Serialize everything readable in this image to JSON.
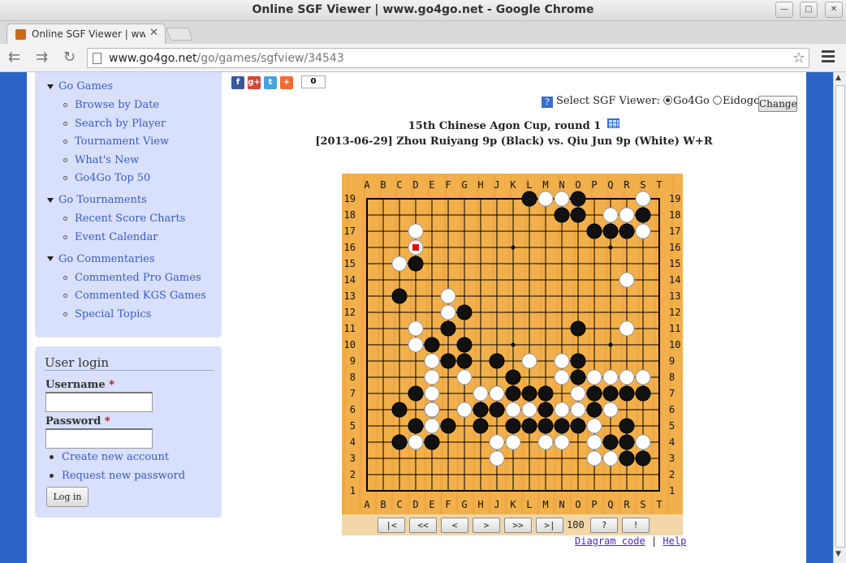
{
  "window": {
    "title": "Online SGF Viewer | www.go4go.net - Google Chrome"
  },
  "tab": {
    "title": "Online SGF Viewer | www.go4go.net"
  },
  "address": {
    "host": "www.go4go.net",
    "path": "/go/games/sgfview/34543"
  },
  "sidebar": {
    "sections": [
      {
        "label": "Go Games",
        "items": [
          "Browse by Date",
          "Search by Player",
          "Tournament View",
          "What's New",
          "Go4Go Top 50"
        ]
      },
      {
        "label": "Go Tournaments",
        "items": [
          "Recent Score Charts",
          "Event Calendar"
        ]
      },
      {
        "label": "Go Commentaries",
        "items": [
          "Commented Pro Games",
          "Commented KGS Games",
          "Special Topics"
        ]
      }
    ]
  },
  "login": {
    "title": "User login",
    "username_label": "Username",
    "password_label": "Password",
    "required_mark": "*",
    "username_value": "",
    "password_value": "",
    "create_account": "Create new account",
    "request_password": "Request new password",
    "login_button": "Log in"
  },
  "share": {
    "count": "0",
    "icons": [
      "facebook-icon",
      "google-plus-icon",
      "twitter-icon",
      "addthis-icon"
    ]
  },
  "viewer_select": {
    "help": "?",
    "label": "Select SGF Viewer:",
    "options": [
      "Go4Go",
      "Eidogo"
    ],
    "selected": "Go4Go",
    "change_button": "Change"
  },
  "game": {
    "event": "15th Chinese Agon Cup, round 1",
    "info": "[2013-06-29] Zhou Ruiyang 9p (Black) vs. Qiu Jun 9p (White) W+R"
  },
  "board": {
    "size": 19,
    "col_labels": [
      "A",
      "B",
      "C",
      "D",
      "E",
      "F",
      "G",
      "H",
      "J",
      "K",
      "L",
      "M",
      "N",
      "O",
      "P",
      "Q",
      "R",
      "S",
      "T"
    ],
    "black": [
      [
        10,
        18
      ],
      [
        13,
        18
      ],
      [
        12,
        17
      ],
      [
        13,
        17
      ],
      [
        14,
        16
      ],
      [
        15,
        16
      ],
      [
        16,
        16
      ],
      [
        17,
        17
      ],
      [
        3,
        14
      ],
      [
        2,
        12
      ],
      [
        6,
        11
      ],
      [
        5,
        10
      ],
      [
        4,
        9
      ],
      [
        6,
        9
      ],
      [
        5,
        8
      ],
      [
        6,
        8
      ],
      [
        8,
        8
      ],
      [
        13,
        10
      ],
      [
        13,
        8
      ],
      [
        9,
        7
      ],
      [
        13,
        7
      ],
      [
        3,
        6
      ],
      [
        8,
        6
      ],
      [
        9,
        6
      ],
      [
        10,
        6
      ],
      [
        11,
        6
      ],
      [
        14,
        6
      ],
      [
        15,
        6
      ],
      [
        16,
        6
      ],
      [
        17,
        6
      ],
      [
        2,
        5
      ],
      [
        4,
        5
      ],
      [
        7,
        5
      ],
      [
        8,
        5
      ],
      [
        11,
        5
      ],
      [
        14,
        5
      ],
      [
        3,
        4
      ],
      [
        5,
        4
      ],
      [
        7,
        4
      ],
      [
        9,
        4
      ],
      [
        10,
        4
      ],
      [
        11,
        4
      ],
      [
        12,
        4
      ],
      [
        13,
        4
      ],
      [
        16,
        4
      ],
      [
        2,
        3
      ],
      [
        4,
        3
      ],
      [
        15,
        3
      ],
      [
        16,
        3
      ],
      [
        16,
        2
      ],
      [
        17,
        2
      ]
    ],
    "white": [
      [
        11,
        18
      ],
      [
        12,
        18
      ],
      [
        17,
        18
      ],
      [
        15,
        17
      ],
      [
        16,
        17
      ],
      [
        17,
        16
      ],
      [
        3,
        16
      ],
      [
        3,
        15
      ],
      [
        2,
        14
      ],
      [
        16,
        13
      ],
      [
        5,
        12
      ],
      [
        5,
        11
      ],
      [
        3,
        10
      ],
      [
        16,
        10
      ],
      [
        3,
        9
      ],
      [
        4,
        8
      ],
      [
        10,
        8
      ],
      [
        12,
        8
      ],
      [
        4,
        7
      ],
      [
        6,
        7
      ],
      [
        12,
        7
      ],
      [
        14,
        7
      ],
      [
        15,
        7
      ],
      [
        16,
        7
      ],
      [
        17,
        7
      ],
      [
        4,
        6
      ],
      [
        7,
        6
      ],
      [
        8,
        6
      ],
      [
        13,
        6
      ],
      [
        4,
        5
      ],
      [
        6,
        5
      ],
      [
        9,
        5
      ],
      [
        10,
        5
      ],
      [
        12,
        5
      ],
      [
        13,
        5
      ],
      [
        15,
        5
      ],
      [
        4,
        4
      ],
      [
        14,
        4
      ],
      [
        3,
        3
      ],
      [
        8,
        3
      ],
      [
        9,
        3
      ],
      [
        11,
        3
      ],
      [
        12,
        3
      ],
      [
        14,
        3
      ],
      [
        17,
        3
      ],
      [
        8,
        2
      ],
      [
        14,
        2
      ],
      [
        15,
        2
      ]
    ],
    "last_move": [
      3,
      15
    ],
    "hoshi": [
      [
        3,
        3
      ],
      [
        9,
        3
      ],
      [
        15,
        3
      ],
      [
        3,
        9
      ],
      [
        9,
        9
      ],
      [
        15,
        9
      ],
      [
        3,
        15
      ],
      [
        9,
        15
      ],
      [
        15,
        15
      ]
    ]
  },
  "controls": {
    "buttons": [
      "|<",
      "<<",
      "<",
      ">",
      ">>",
      ">|"
    ],
    "move_number": "100",
    "help": "?",
    "alert": "!"
  },
  "footer_links": {
    "diagram": "Diagram code",
    "separator": "|",
    "help": "Help"
  },
  "colors": {
    "board": "#f2b04c",
    "page_bg": "#2a64c5",
    "sidebar_bg": "#d8e0fc",
    "link": "#3a5bc4",
    "last_move_marker": "#dd1111"
  }
}
